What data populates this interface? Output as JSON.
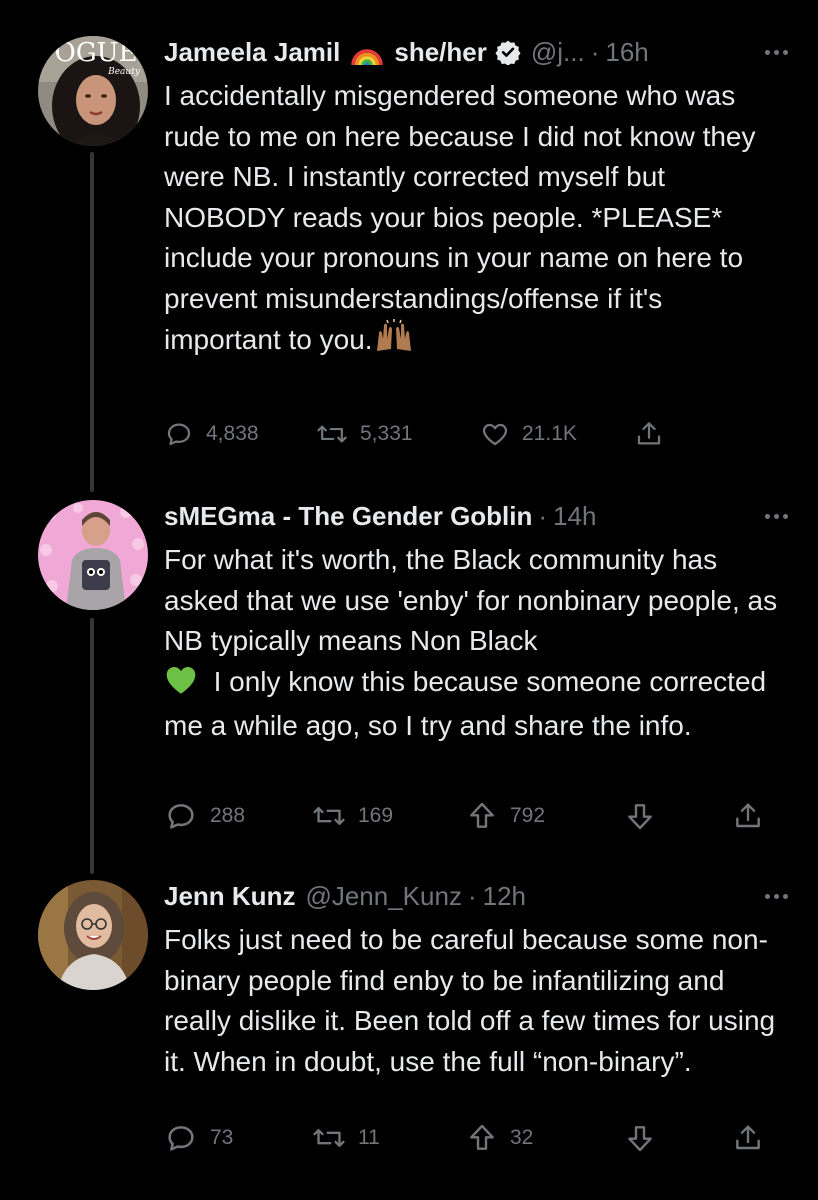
{
  "colors": {
    "background": "#000000",
    "text": "#e7e9ea",
    "secondary": "#71767b",
    "thread_line": "#333639",
    "verified": "#e7e9ea"
  },
  "tweets": [
    {
      "name": "Jameela Jamil",
      "pronouns": "she/her",
      "handle": "@j...",
      "time": "16h",
      "verified": true,
      "avatar_text": "OGUE",
      "avatar_subtext": "Beauty",
      "text": "I accidentally misgendered someone who was rude to me on here because I did not know they were NB. I instantly corrected myself but NOBODY reads your bios people. *PLEASE* include your pronouns in your name on here to prevent misunderstandings/offense if it's important to you.",
      "emoji": "raising-hands",
      "actions": {
        "replies": "4,838",
        "retweets": "5,331",
        "likes": "21.1K"
      }
    },
    {
      "name": "sMEGma - The Gender Goblin",
      "handle": "",
      "time": "14h",
      "text_before_emoji": "For what it's worth, the Black community has asked that we use 'enby' for nonbinary people, as NB typically means Non Black",
      "emoji": "green-heart",
      "text_after_emoji": "I only know this because someone corrected me a while ago, so I try and share the info.",
      "actions": {
        "replies": "288",
        "retweets": "169",
        "upvotes": "792"
      }
    },
    {
      "name": "Jenn Kunz",
      "handle": "@Jenn_Kunz",
      "time": "12h",
      "text": "Folks just need to be careful because some non-binary people find enby to be infantilizing and really dislike it. Been told off a few times for using it. When in doubt, use the full “non-binary”.",
      "actions": {
        "replies": "73",
        "retweets": "11",
        "upvotes": "32"
      }
    }
  ]
}
